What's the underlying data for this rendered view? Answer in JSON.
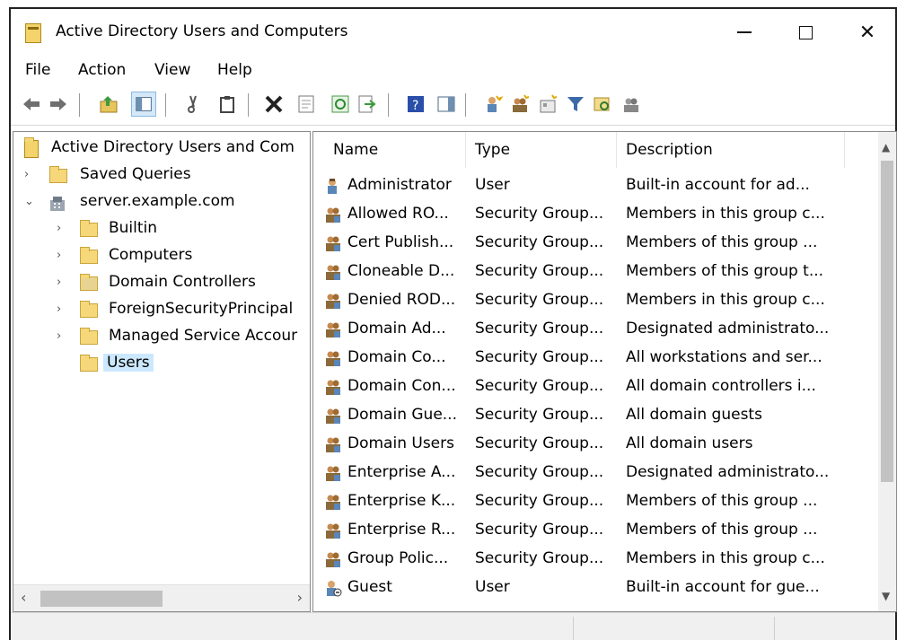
{
  "window": {
    "title": "Active Directory Users and Computers"
  },
  "menu": [
    "File",
    "Action",
    "View",
    "Help"
  ],
  "toolbar_icons": [
    "back-icon",
    "forward-icon",
    "up-folder-icon",
    "show-console-tree-icon",
    "cut-icon",
    "copy-icon",
    "delete-icon",
    "properties-icon",
    "refresh-icon",
    "export-list-icon",
    "help-icon",
    "action-pane-icon",
    "new-user-icon",
    "new-group-icon",
    "new-ou-icon",
    "filter-icon",
    "find-icon",
    "add-to-group-icon"
  ],
  "tree": {
    "root": "Active Directory Users and Com",
    "saved_queries": "Saved Queries",
    "domain": "server.example.com",
    "children": [
      "Builtin",
      "Computers",
      "Domain Controllers",
      "ForeignSecurityPrincipal",
      "Managed Service Accour",
      "Users"
    ]
  },
  "columns": [
    "Name",
    "Type",
    "Description"
  ],
  "rows": [
    {
      "name": "Administrator",
      "type": "User",
      "desc": "Built-in account for ad...",
      "icon": "user-icon"
    },
    {
      "name": "Allowed RO...",
      "type": "Security Group...",
      "desc": "Members in this group c...",
      "icon": "group-icon"
    },
    {
      "name": "Cert Publish...",
      "type": "Security Group...",
      "desc": "Members of this group ...",
      "icon": "group-icon"
    },
    {
      "name": "Cloneable D...",
      "type": "Security Group...",
      "desc": "Members of this group t...",
      "icon": "group-icon"
    },
    {
      "name": "Denied ROD...",
      "type": "Security Group...",
      "desc": "Members in this group c...",
      "icon": "group-icon"
    },
    {
      "name": "Domain Ad...",
      "type": "Security Group...",
      "desc": "Designated administrato...",
      "icon": "group-icon"
    },
    {
      "name": "Domain Co...",
      "type": "Security Group...",
      "desc": "All workstations and ser...",
      "icon": "group-icon"
    },
    {
      "name": "Domain Con...",
      "type": "Security Group...",
      "desc": "All domain controllers i...",
      "icon": "group-icon"
    },
    {
      "name": "Domain Gue...",
      "type": "Security Group...",
      "desc": "All domain guests",
      "icon": "group-icon"
    },
    {
      "name": "Domain Users",
      "type": "Security Group...",
      "desc": "All domain users",
      "icon": "group-icon"
    },
    {
      "name": "Enterprise A...",
      "type": "Security Group...",
      "desc": "Designated administrato...",
      "icon": "group-icon"
    },
    {
      "name": "Enterprise K...",
      "type": "Security Group...",
      "desc": "Members of this group ...",
      "icon": "group-icon"
    },
    {
      "name": "Enterprise R...",
      "type": "Security Group...",
      "desc": "Members of this group ...",
      "icon": "group-icon"
    },
    {
      "name": "Group Polic...",
      "type": "Security Group...",
      "desc": "Members in this group c...",
      "icon": "group-icon"
    },
    {
      "name": "Guest",
      "type": "User",
      "desc": "Built-in account for gue...",
      "icon": "disabled-user-icon"
    }
  ],
  "colors": {
    "selection": "#cce8ff",
    "folder": "#f6d77a",
    "group_people": "#8a6a3a",
    "user_body": "#6d8fb6"
  }
}
